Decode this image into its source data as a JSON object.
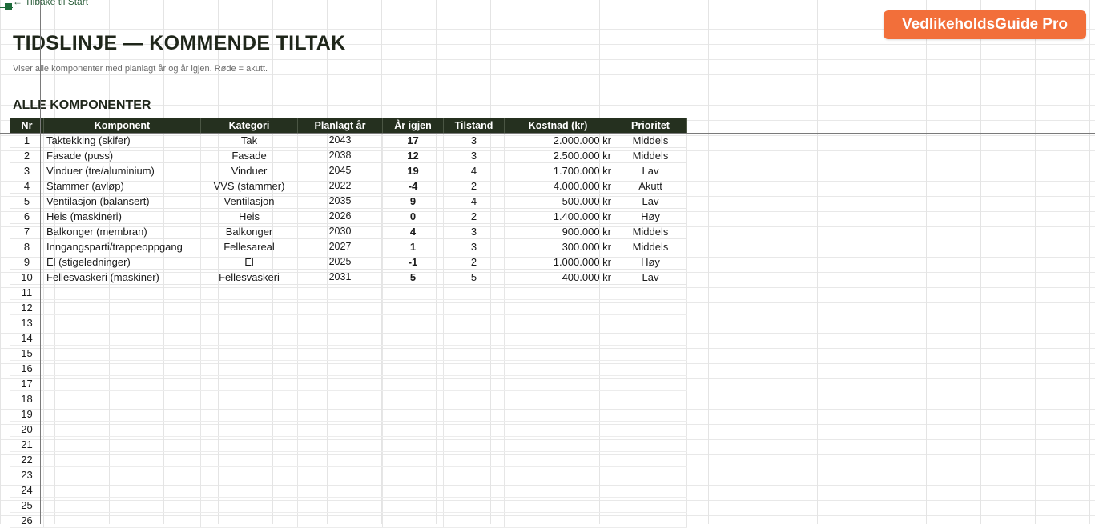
{
  "nav": {
    "back_label": "← Tilbake til Start"
  },
  "header": {
    "title": "TIDSLINJE — KOMMENDE TILTAK",
    "subtitle": "Viser alle komponenter med planlagt år og år igjen. Røde = akutt.",
    "section_title": "ALLE KOMPONENTER"
  },
  "brand": {
    "label": "VedlikeholdsGuide Pro",
    "color": "#f26f3a"
  },
  "table": {
    "columns": [
      "Nr",
      "Komponent",
      "Kategori",
      "Planlagt år",
      "År igjen",
      "Tilstand",
      "Kostnad (kr)",
      "Prioritet"
    ],
    "rows": [
      [
        "1",
        "Taktekking (skifer)",
        "Tak",
        "2043",
        "17",
        "3",
        "2.000.000 kr",
        "Middels"
      ],
      [
        "2",
        "Fasade (puss)",
        "Fasade",
        "2038",
        "12",
        "3",
        "2.500.000 kr",
        "Middels"
      ],
      [
        "3",
        "Vinduer (tre/aluminium)",
        "Vinduer",
        "2045",
        "19",
        "4",
        "1.700.000 kr",
        "Lav"
      ],
      [
        "4",
        "Stammer (avløp)",
        "VVS (stammer)",
        "2022",
        "-4",
        "2",
        "4.000.000 kr",
        "Akutt"
      ],
      [
        "5",
        "Ventilasjon (balansert)",
        "Ventilasjon",
        "2035",
        "9",
        "4",
        "500.000 kr",
        "Lav"
      ],
      [
        "6",
        "Heis (maskineri)",
        "Heis",
        "2026",
        "0",
        "2",
        "1.400.000 kr",
        "Høy"
      ],
      [
        "7",
        "Balkonger (membran)",
        "Balkonger",
        "2030",
        "4",
        "3",
        "900.000 kr",
        "Middels"
      ],
      [
        "8",
        "Inngangsparti/trappeoppgang",
        "Fellesareal",
        "2027",
        "1",
        "3",
        "300.000 kr",
        "Middels"
      ],
      [
        "9",
        "El (stigeledninger)",
        "El",
        "2025",
        "-1",
        "2",
        "1.000.000 kr",
        "Høy"
      ],
      [
        "10",
        "Fellesvaskeri (maskiner)",
        "Fellesvaskeri",
        "2031",
        "5",
        "5",
        "400.000 kr",
        "Lav"
      ]
    ],
    "empty_row_numbers": [
      "11",
      "12",
      "13",
      "14",
      "15",
      "16",
      "17",
      "18",
      "19",
      "20",
      "21",
      "22",
      "23",
      "24",
      "25",
      "26"
    ]
  },
  "colors": {
    "header_bg": "#25301f",
    "accent": "#f26f3a"
  }
}
